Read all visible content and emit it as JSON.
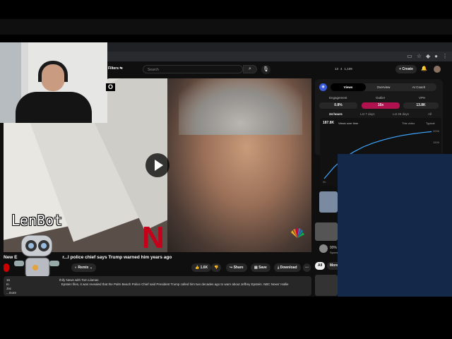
{
  "youtube_header": {
    "filters_label": "Filters",
    "search_placeholder": "Search",
    "stats": [
      "13",
      "4",
      "1,109"
    ],
    "create_label": "Create"
  },
  "video": {
    "title_visible_left": "New E",
    "title_visible_right": "r...l police chief says Trump warned him years ago",
    "channel_fragment": "thify News with Tom Llamas",
    "description_line": "Epstein files, it was revealed that the Palm Beach Police Chief said President Trump called him two decades ago to warn about Jeffrey Epstein. NBC News' Hallie",
    "description_prefix": "16",
    "description_prefix2": "In",
    "description_prefix3": "Jac",
    "more_label": "...more",
    "overlay_logo_letter": "N"
  },
  "actions": {
    "remix_label": "Remix",
    "like_count": "1.6K",
    "share_label": "Share",
    "save_label": "Save",
    "download_label": "Download"
  },
  "analytics_panel": {
    "tabs": [
      "Views",
      "Overview",
      "AI Coach"
    ],
    "active_tab": "Views",
    "metrics": [
      {
        "label": "Engagement",
        "value": "0.8%"
      },
      {
        "label": "Outlier",
        "value": "16x"
      },
      {
        "label": "VPH",
        "value": "13.8K"
      }
    ],
    "ranges": [
      "24 hours",
      "Lst 7 days",
      "Lst 28 days",
      "All"
    ],
    "views_value": "187.8K",
    "views_sublabel": "Views over time",
    "legend_this": "This video",
    "legend_typical": "Typical",
    "y_ticks": [
      "200K",
      "150K"
    ],
    "x_tick_start": "0h",
    "outlier_color": "#b0124f"
  },
  "chart_data": {
    "type": "line",
    "title": "",
    "series": [
      {
        "name": "This video",
        "values": [
          0,
          45,
          80,
          105,
          125,
          140,
          152,
          162,
          170,
          176,
          181,
          185
        ]
      }
    ],
    "x": [
      0,
      1,
      2,
      3,
      4,
      5,
      6,
      7,
      8,
      9,
      10,
      11
    ],
    "ylim": [
      0,
      200
    ],
    "grid": false,
    "legend": "top-right"
  },
  "sidebar": {
    "pct_label": "90%",
    "spons_label": "Spons",
    "all_chip": "All",
    "more_chip": "More"
  },
  "overlays": {
    "bot_name": "LenBot",
    "cam_label": "O"
  }
}
